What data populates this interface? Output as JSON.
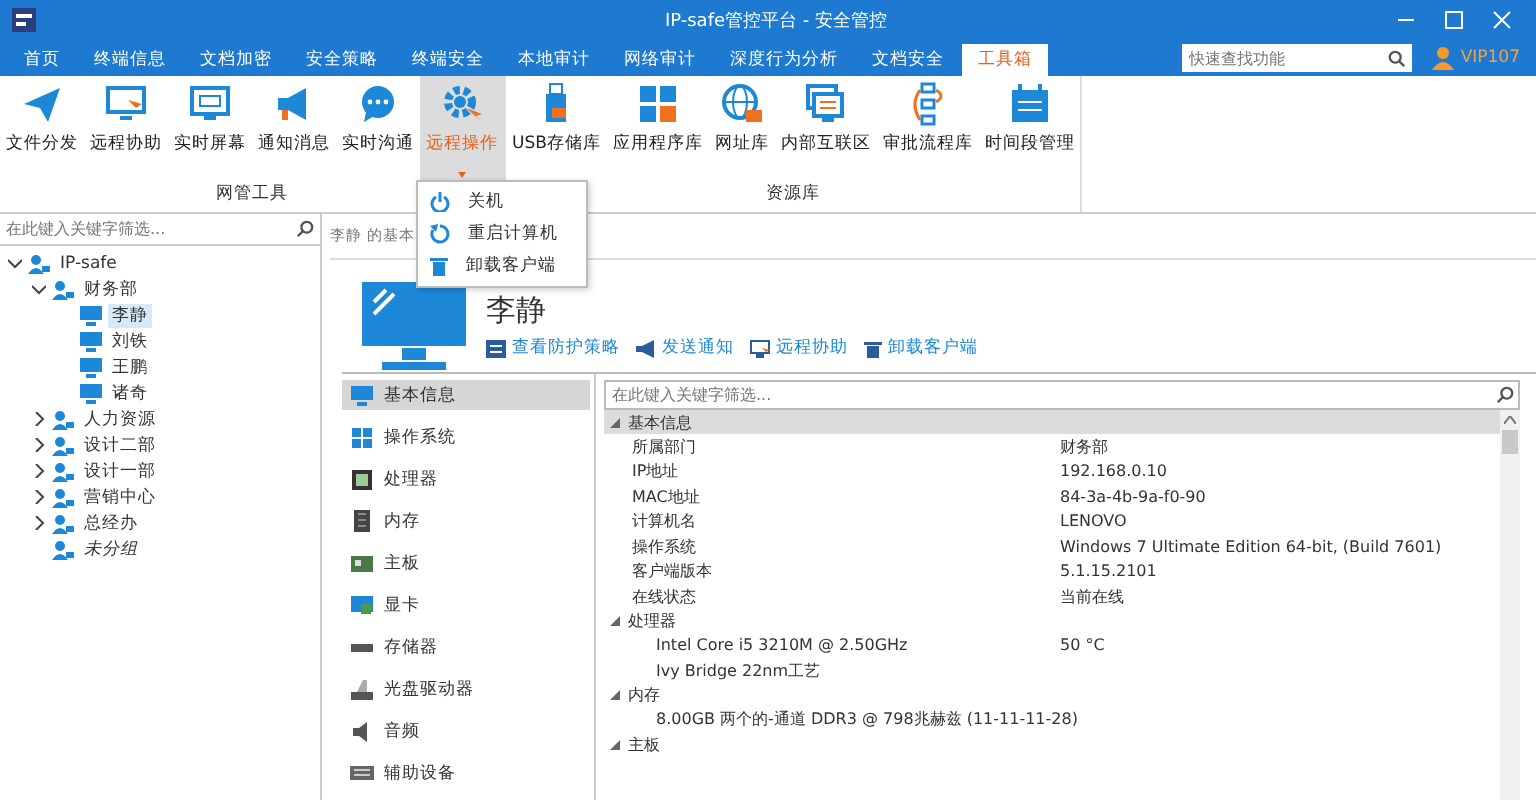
{
  "window": {
    "title": "IP-safe管控平台 - 安全管控"
  },
  "tabs": [
    {
      "label": "首页",
      "selected": false
    },
    {
      "label": "终端信息",
      "selected": false
    },
    {
      "label": "文档加密",
      "selected": false
    },
    {
      "label": "安全策略",
      "selected": false
    },
    {
      "label": "终端安全",
      "selected": false
    },
    {
      "label": "本地审计",
      "selected": false
    },
    {
      "label": "网络审计",
      "selected": false
    },
    {
      "label": "深度行为分析",
      "selected": false
    },
    {
      "label": "文档安全",
      "selected": false
    },
    {
      "label": "工具箱",
      "selected": true
    }
  ],
  "quick_search": {
    "placeholder": "快速查找功能"
  },
  "user": {
    "name": "VIP107"
  },
  "ribbon": {
    "groups": [
      {
        "label": "网管工具",
        "items": [
          {
            "label": "文件分发",
            "kind": "send",
            "selected": false
          },
          {
            "label": "远程协助",
            "kind": "remote",
            "selected": false
          },
          {
            "label": "实时屏幕",
            "kind": "screen",
            "selected": false
          },
          {
            "label": "通知消息",
            "kind": "megaphone",
            "selected": false
          },
          {
            "label": "实时沟通",
            "kind": "chat",
            "selected": false
          },
          {
            "label": "远程操作",
            "kind": "gear",
            "selected": true
          }
        ]
      },
      {
        "label": "资源库",
        "items": [
          {
            "label": "USB存储库",
            "kind": "usb",
            "selected": false
          },
          {
            "label": "应用程序库",
            "kind": "apps",
            "selected": false
          },
          {
            "label": "网址库",
            "kind": "globe",
            "selected": false
          },
          {
            "label": "内部互联区",
            "kind": "intranet",
            "selected": false
          },
          {
            "label": "审批流程库",
            "kind": "flow",
            "selected": false
          },
          {
            "label": "时间段管理",
            "kind": "calendar",
            "selected": false
          }
        ]
      }
    ]
  },
  "dropdown": {
    "items": [
      {
        "label": "关机",
        "kind": "power"
      },
      {
        "label": "重启计算机",
        "kind": "restart"
      },
      {
        "label": "卸载客户端",
        "kind": "trash"
      }
    ]
  },
  "sidebar": {
    "filter": {
      "placeholder": "在此键入关键字筛选..."
    },
    "tree": [
      {
        "label": "IP-safe",
        "kind": "group",
        "expanded": true,
        "children": [
          {
            "label": "财务部",
            "kind": "group",
            "expanded": true,
            "children": [
              {
                "label": "李静",
                "kind": "computer",
                "selected": true
              },
              {
                "label": "刘铁",
                "kind": "computer",
                "selected": false
              },
              {
                "label": "王鹏",
                "kind": "computer",
                "selected": false
              },
              {
                "label": "诸奇",
                "kind": "computer",
                "selected": false
              }
            ]
          },
          {
            "label": "人力资源",
            "kind": "group",
            "expanded": false
          },
          {
            "label": "设计二部",
            "kind": "group",
            "expanded": false
          },
          {
            "label": "设计一部",
            "kind": "group",
            "expanded": false
          },
          {
            "label": "营销中心",
            "kind": "group",
            "expanded": false
          },
          {
            "label": "总经办",
            "kind": "group",
            "expanded": false
          },
          {
            "label": "未分组",
            "kind": "ungrouped"
          }
        ]
      }
    ]
  },
  "breadcrumb": "李静 的基本",
  "computer": {
    "name": "李静",
    "actions": [
      {
        "label": "查看防护策略",
        "kind": "policy"
      },
      {
        "label": "发送通知",
        "kind": "megaphone"
      },
      {
        "label": "远程协助",
        "kind": "remote"
      },
      {
        "label": "卸载客户端",
        "kind": "trash"
      }
    ]
  },
  "categories": [
    {
      "label": "基本信息",
      "kind": "monitor",
      "selected": true
    },
    {
      "label": "操作系统",
      "kind": "windows",
      "selected": false
    },
    {
      "label": "处理器",
      "kind": "cpu",
      "selected": false
    },
    {
      "label": "内存",
      "kind": "memory",
      "selected": false
    },
    {
      "label": "主板",
      "kind": "board",
      "selected": false
    },
    {
      "label": "显卡",
      "kind": "gpu",
      "selected": false
    },
    {
      "label": "存储器",
      "kind": "storage",
      "selected": false
    },
    {
      "label": "光盘驱动器",
      "kind": "disc",
      "selected": false
    },
    {
      "label": "音频",
      "kind": "audio",
      "selected": false
    },
    {
      "label": "辅助设备",
      "kind": "keyboard",
      "selected": false
    }
  ],
  "details": {
    "filter": {
      "placeholder": "在此键入关键字筛选..."
    },
    "sections": [
      {
        "label": "基本信息",
        "expanded": true,
        "selected": true,
        "rows": [
          {
            "label": "所属部门",
            "value": "财务部"
          },
          {
            "label": "IP地址",
            "value": "192.168.0.10"
          },
          {
            "label": "MAC地址",
            "value": "84-3a-4b-9a-f0-90"
          },
          {
            "label": "计算机名",
            "value": "LENOVO"
          },
          {
            "label": "操作系统",
            "value": "Windows 7 Ultimate Edition 64-bit, (Build 7601)"
          },
          {
            "label": "客户端版本",
            "value": "5.1.15.2101"
          },
          {
            "label": "在线状态",
            "value": "当前在线"
          }
        ]
      },
      {
        "label": "处理器",
        "expanded": true,
        "selected": false,
        "rows": [
          {
            "label": "Intel Core i5 3210M @ 2.50GHz",
            "value": "50 °C"
          },
          {
            "label": "Ivy Bridge 22nm工艺"
          }
        ]
      },
      {
        "label": "内存",
        "expanded": true,
        "selected": false,
        "rows": [
          {
            "label": "8.00GB 两个的-通道 DDR3 @ 798兆赫兹 (11-11-11-28)"
          }
        ]
      },
      {
        "label": "主板",
        "expanded": true,
        "selected": false
      }
    ]
  }
}
